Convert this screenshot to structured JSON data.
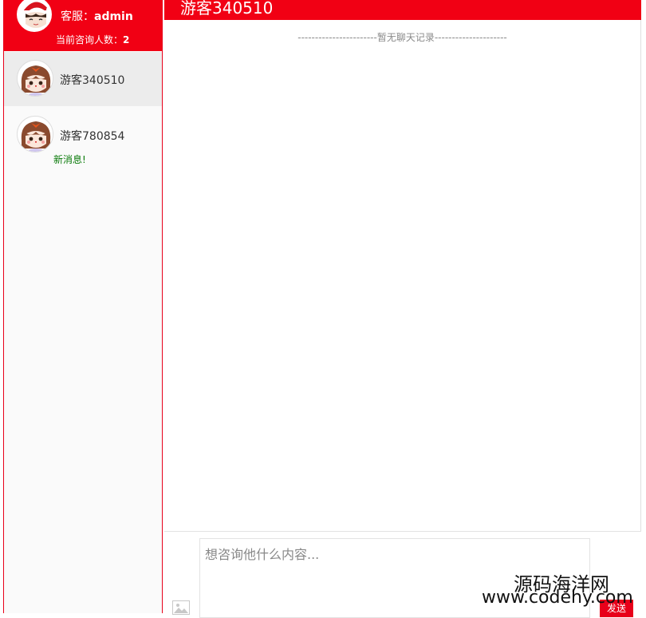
{
  "agent": {
    "label": "客服：",
    "name": "admin",
    "count_label": "当前咨询人数：",
    "count": "2"
  },
  "visitors": [
    {
      "name": "游客340510",
      "status": ""
    },
    {
      "name": "游客780854",
      "status": "新消息!"
    }
  ],
  "chat": {
    "title": "游客340510",
    "empty_text": "-----------------------暂无聊天记录---------------------"
  },
  "input": {
    "placeholder": "想咨询他什么内容...",
    "send_label": "发送"
  },
  "watermark": {
    "cn": "源码海洋网",
    "url": "www.codehy.com"
  },
  "colors": {
    "brand": "#f10014",
    "new_message": "#0a7a0a"
  }
}
